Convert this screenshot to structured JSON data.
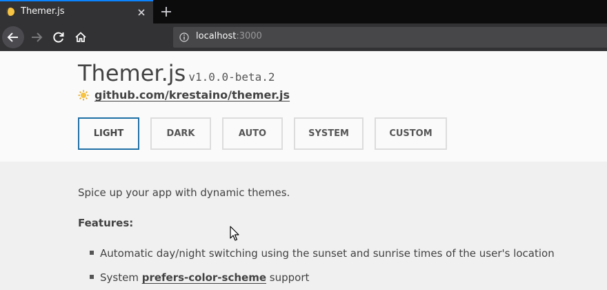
{
  "browser": {
    "tab_title": "Themer.js",
    "url_host": "localhost",
    "url_port": ":3000"
  },
  "header": {
    "title": "Themer.js",
    "version": "v1.0.0-beta.2",
    "repo_link": "github.com/krestaino/themer.js"
  },
  "theme_buttons": {
    "light": "LIGHT",
    "dark": "DARK",
    "auto": "AUTO",
    "system": "SYSTEM",
    "custom": "CUSTOM",
    "selected": "LIGHT"
  },
  "content": {
    "tagline": "Spice up your app with dynamic themes.",
    "features_heading": "Features:",
    "feature_1": "Automatic day/night switching using the sunset and sunrise times of the user's location",
    "feature_2_prefix": "System ",
    "feature_2_link": "prefers-color-scheme",
    "feature_2_suffix": " support"
  },
  "colors": {
    "accent_border": "#1d6fa5",
    "text": "#424242",
    "header_bg": "#fafafa",
    "content_bg": "#f0f0f0",
    "browser_tab_accent": "#0a84ff"
  },
  "icons": [
    "moon-favicon-icon",
    "close-icon",
    "plus-icon",
    "back-arrow-icon",
    "forward-arrow-icon",
    "reload-icon",
    "home-icon",
    "info-icon",
    "sun-icon",
    "cursor-pointer-icon"
  ]
}
